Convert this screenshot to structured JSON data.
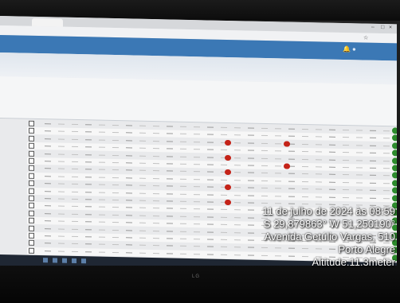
{
  "monitor": {
    "brand": "LG"
  },
  "stamp": {
    "date": "11 de julho de 2024 às 08:59",
    "coords": "S 29,879863° W 51,250190°",
    "street": "Avenida Getúlio Vargas, 510",
    "city": "Porto Alegre",
    "altitude": "Altitude:11.3meter"
  },
  "colors": {
    "appbar": "#3b78b5",
    "marker": "#c42318",
    "status_ok": "#2c8b2c"
  }
}
